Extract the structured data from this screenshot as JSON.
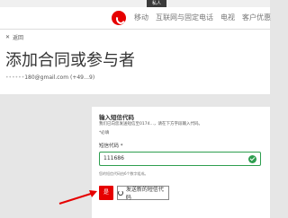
{
  "topstrip": {
    "tab_label": "私人",
    "dim_label": ""
  },
  "nav": {
    "items": [
      "移动",
      "互联网与固定电话",
      "电视",
      "客户优惠"
    ]
  },
  "subheader": {
    "back_label": "返回",
    "close_icon": "close-icon"
  },
  "page": {
    "title": "添加合同或参与者"
  },
  "account": {
    "email": "180@gmail.com",
    "phone": "(+49…9)"
  },
  "card": {
    "title": "输入短信代码",
    "desc": "我们已向您发送短信至0174…，请在下方字段输入代码。",
    "required": "*必填",
    "field_label": "短信代码 *",
    "code_value": "111686",
    "hint": "您的短信代码由6个数字组成。",
    "ok_label": "是",
    "resend_label": "发送新的短信代码"
  },
  "colors": {
    "accent": "#e60000",
    "success": "#2e9e4f"
  }
}
